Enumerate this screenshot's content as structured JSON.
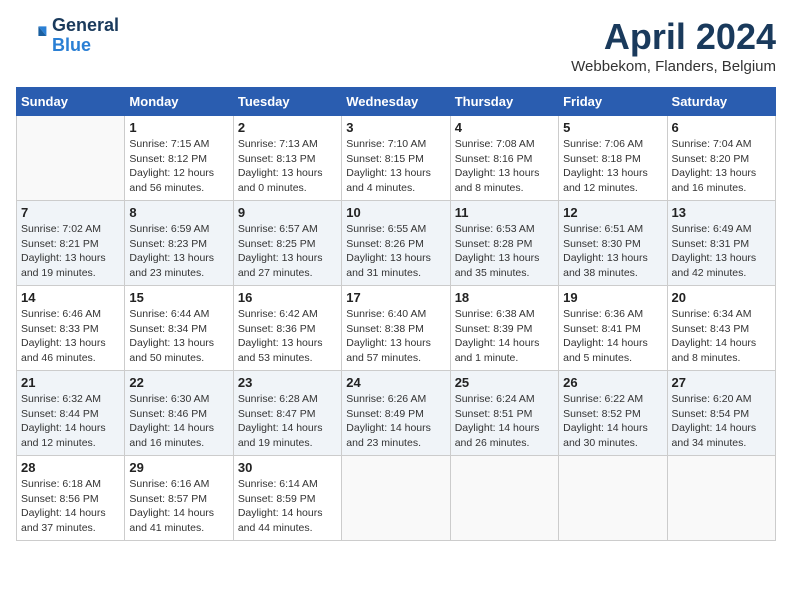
{
  "logo": {
    "line1": "General",
    "line2": "Blue"
  },
  "title": "April 2024",
  "subtitle": "Webbekom, Flanders, Belgium",
  "weekdays": [
    "Sunday",
    "Monday",
    "Tuesday",
    "Wednesday",
    "Thursday",
    "Friday",
    "Saturday"
  ],
  "weeks": [
    [
      {
        "day": "",
        "info": ""
      },
      {
        "day": "1",
        "info": "Sunrise: 7:15 AM\nSunset: 8:12 PM\nDaylight: 12 hours\nand 56 minutes."
      },
      {
        "day": "2",
        "info": "Sunrise: 7:13 AM\nSunset: 8:13 PM\nDaylight: 13 hours\nand 0 minutes."
      },
      {
        "day": "3",
        "info": "Sunrise: 7:10 AM\nSunset: 8:15 PM\nDaylight: 13 hours\nand 4 minutes."
      },
      {
        "day": "4",
        "info": "Sunrise: 7:08 AM\nSunset: 8:16 PM\nDaylight: 13 hours\nand 8 minutes."
      },
      {
        "day": "5",
        "info": "Sunrise: 7:06 AM\nSunset: 8:18 PM\nDaylight: 13 hours\nand 12 minutes."
      },
      {
        "day": "6",
        "info": "Sunrise: 7:04 AM\nSunset: 8:20 PM\nDaylight: 13 hours\nand 16 minutes."
      }
    ],
    [
      {
        "day": "7",
        "info": "Sunrise: 7:02 AM\nSunset: 8:21 PM\nDaylight: 13 hours\nand 19 minutes."
      },
      {
        "day": "8",
        "info": "Sunrise: 6:59 AM\nSunset: 8:23 PM\nDaylight: 13 hours\nand 23 minutes."
      },
      {
        "day": "9",
        "info": "Sunrise: 6:57 AM\nSunset: 8:25 PM\nDaylight: 13 hours\nand 27 minutes."
      },
      {
        "day": "10",
        "info": "Sunrise: 6:55 AM\nSunset: 8:26 PM\nDaylight: 13 hours\nand 31 minutes."
      },
      {
        "day": "11",
        "info": "Sunrise: 6:53 AM\nSunset: 8:28 PM\nDaylight: 13 hours\nand 35 minutes."
      },
      {
        "day": "12",
        "info": "Sunrise: 6:51 AM\nSunset: 8:30 PM\nDaylight: 13 hours\nand 38 minutes."
      },
      {
        "day": "13",
        "info": "Sunrise: 6:49 AM\nSunset: 8:31 PM\nDaylight: 13 hours\nand 42 minutes."
      }
    ],
    [
      {
        "day": "14",
        "info": "Sunrise: 6:46 AM\nSunset: 8:33 PM\nDaylight: 13 hours\nand 46 minutes."
      },
      {
        "day": "15",
        "info": "Sunrise: 6:44 AM\nSunset: 8:34 PM\nDaylight: 13 hours\nand 50 minutes."
      },
      {
        "day": "16",
        "info": "Sunrise: 6:42 AM\nSunset: 8:36 PM\nDaylight: 13 hours\nand 53 minutes."
      },
      {
        "day": "17",
        "info": "Sunrise: 6:40 AM\nSunset: 8:38 PM\nDaylight: 13 hours\nand 57 minutes."
      },
      {
        "day": "18",
        "info": "Sunrise: 6:38 AM\nSunset: 8:39 PM\nDaylight: 14 hours\nand 1 minute."
      },
      {
        "day": "19",
        "info": "Sunrise: 6:36 AM\nSunset: 8:41 PM\nDaylight: 14 hours\nand 5 minutes."
      },
      {
        "day": "20",
        "info": "Sunrise: 6:34 AM\nSunset: 8:43 PM\nDaylight: 14 hours\nand 8 minutes."
      }
    ],
    [
      {
        "day": "21",
        "info": "Sunrise: 6:32 AM\nSunset: 8:44 PM\nDaylight: 14 hours\nand 12 minutes."
      },
      {
        "day": "22",
        "info": "Sunrise: 6:30 AM\nSunset: 8:46 PM\nDaylight: 14 hours\nand 16 minutes."
      },
      {
        "day": "23",
        "info": "Sunrise: 6:28 AM\nSunset: 8:47 PM\nDaylight: 14 hours\nand 19 minutes."
      },
      {
        "day": "24",
        "info": "Sunrise: 6:26 AM\nSunset: 8:49 PM\nDaylight: 14 hours\nand 23 minutes."
      },
      {
        "day": "25",
        "info": "Sunrise: 6:24 AM\nSunset: 8:51 PM\nDaylight: 14 hours\nand 26 minutes."
      },
      {
        "day": "26",
        "info": "Sunrise: 6:22 AM\nSunset: 8:52 PM\nDaylight: 14 hours\nand 30 minutes."
      },
      {
        "day": "27",
        "info": "Sunrise: 6:20 AM\nSunset: 8:54 PM\nDaylight: 14 hours\nand 34 minutes."
      }
    ],
    [
      {
        "day": "28",
        "info": "Sunrise: 6:18 AM\nSunset: 8:56 PM\nDaylight: 14 hours\nand 37 minutes."
      },
      {
        "day": "29",
        "info": "Sunrise: 6:16 AM\nSunset: 8:57 PM\nDaylight: 14 hours\nand 41 minutes."
      },
      {
        "day": "30",
        "info": "Sunrise: 6:14 AM\nSunset: 8:59 PM\nDaylight: 14 hours\nand 44 minutes."
      },
      {
        "day": "",
        "info": ""
      },
      {
        "day": "",
        "info": ""
      },
      {
        "day": "",
        "info": ""
      },
      {
        "day": "",
        "info": ""
      }
    ]
  ]
}
